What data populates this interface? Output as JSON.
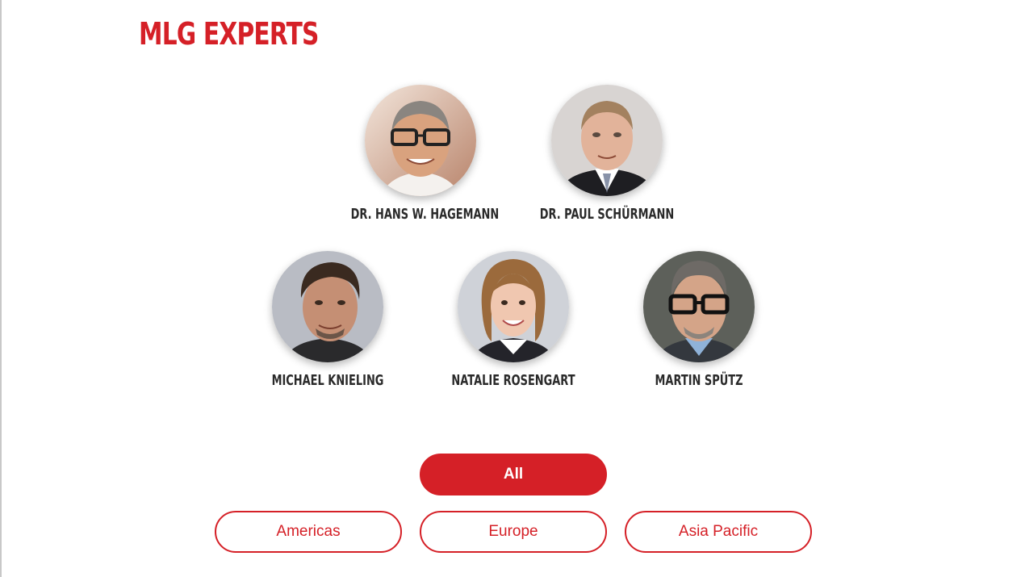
{
  "page": {
    "title": "MLG EXPERTS"
  },
  "experts": [
    {
      "name": "DR. HANS W. HAGEMANN",
      "photo": "portrait-photo"
    },
    {
      "name": "DR. PAUL SCHÜRMANN",
      "photo": "portrait-photo"
    },
    {
      "name": "MICHAEL KNIELING",
      "photo": "portrait-photo"
    },
    {
      "name": "NATALIE ROSENGART",
      "photo": "portrait-photo"
    },
    {
      "name": "MARTIN SPÜTZ",
      "photo": "portrait-photo"
    }
  ],
  "filters": {
    "active": "All",
    "items": [
      {
        "label": "All"
      },
      {
        "label": "Americas"
      },
      {
        "label": "Europe"
      },
      {
        "label": "Asia Pacific"
      }
    ]
  },
  "colors": {
    "accent": "#d52027",
    "name_text": "#2a2a2a",
    "background": "#ffffff"
  }
}
